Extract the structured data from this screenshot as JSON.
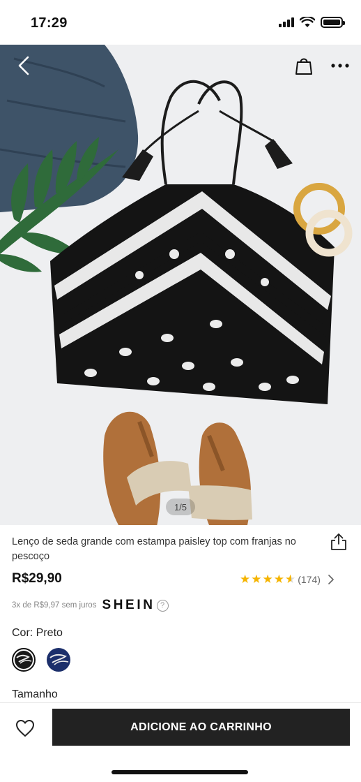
{
  "status_bar": {
    "time": "17:29",
    "icons": [
      "signal-icon",
      "wifi-icon",
      "battery-icon"
    ]
  },
  "product_image": {
    "page_indicator": "1/5",
    "nav_icons": [
      "chevron-left-icon",
      "shopping-bag-icon",
      "more-dots-icon"
    ]
  },
  "product": {
    "title": "Lenço de seda grande com estampa paisley top com franjas no pescoço",
    "price": "R$29,90",
    "rating_value": 4.5,
    "review_count": "(174)",
    "installments_text": "3x de R$9,97 sem juros",
    "installments_brand": "SHEIN",
    "help_symbol": "?"
  },
  "color": {
    "label": "Cor: Preto",
    "options": [
      {
        "name": "Preto",
        "hex": "#1a1a1a",
        "selected": true
      },
      {
        "name": "Azul",
        "hex": "#1c2f6b",
        "selected": false
      }
    ]
  },
  "size": {
    "label": "Tamanho"
  },
  "bottom_bar": {
    "add_to_cart_label": "ADICIONE AO CARRINHO",
    "wishlist_icon": "heart-outline-icon"
  },
  "colors": {
    "accent": "#222222",
    "star": "#f5b400",
    "background": "#ffffff"
  }
}
